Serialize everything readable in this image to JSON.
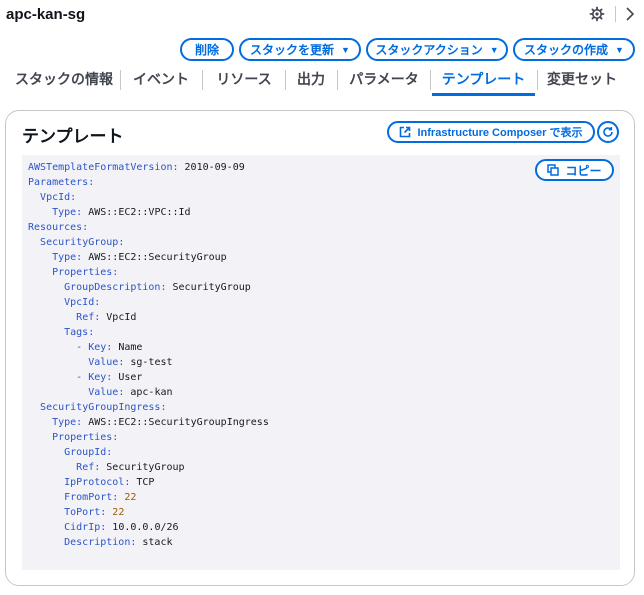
{
  "header": {
    "stack_name": "apc-kan-sg"
  },
  "actions": {
    "delete": "削除",
    "update": "スタックを更新",
    "stack_actions": "スタックアクション",
    "create": "スタックの作成"
  },
  "tabs": [
    {
      "label": "スタックの情報"
    },
    {
      "label": "イベント"
    },
    {
      "label": "リソース"
    },
    {
      "label": "出力"
    },
    {
      "label": "パラメータ"
    },
    {
      "label": "テンプレート"
    },
    {
      "label": "変更セット"
    }
  ],
  "panel": {
    "title": "テンプレート",
    "composer_label": "Infrastructure Composer で表示",
    "copy_label": "コピー"
  },
  "template_lines": [
    {
      "indent": "",
      "key": "AWSTemplateFormatVersion:",
      "value": " 2010-09-09",
      "vtype": "v"
    },
    {
      "indent": "",
      "key": "Parameters:",
      "value": "",
      "vtype": "v"
    },
    {
      "indent": "  ",
      "key": "VpcId:",
      "value": "",
      "vtype": "v"
    },
    {
      "indent": "    ",
      "key": "Type:",
      "value": " AWS::EC2::VPC::Id",
      "vtype": "v"
    },
    {
      "indent": "",
      "key": "Resources:",
      "value": "",
      "vtype": "v"
    },
    {
      "indent": "  ",
      "key": "SecurityGroup:",
      "value": "",
      "vtype": "v"
    },
    {
      "indent": "    ",
      "key": "Type:",
      "value": " AWS::EC2::SecurityGroup",
      "vtype": "v"
    },
    {
      "indent": "    ",
      "key": "Properties:",
      "value": "",
      "vtype": "v"
    },
    {
      "indent": "      ",
      "key": "GroupDescription:",
      "value": " SecurityGroup",
      "vtype": "v"
    },
    {
      "indent": "      ",
      "key": "VpcId:",
      "value": "",
      "vtype": "v"
    },
    {
      "indent": "        ",
      "key": "Ref:",
      "value": " VpcId",
      "vtype": "v"
    },
    {
      "indent": "      ",
      "key": "Tags:",
      "value": "",
      "vtype": "v"
    },
    {
      "indent": "        ",
      "key": "- Key:",
      "value": " Name",
      "vtype": "v"
    },
    {
      "indent": "          ",
      "key": "Value:",
      "value": " sg-test",
      "vtype": "v"
    },
    {
      "indent": "        ",
      "key": "- Key:",
      "value": " User",
      "vtype": "v"
    },
    {
      "indent": "          ",
      "key": "Value:",
      "value": " apc-kan",
      "vtype": "v"
    },
    {
      "indent": "  ",
      "key": "SecurityGroupIngress:",
      "value": "",
      "vtype": "v"
    },
    {
      "indent": "    ",
      "key": "Type:",
      "value": " AWS::EC2::SecurityGroupIngress",
      "vtype": "v"
    },
    {
      "indent": "    ",
      "key": "Properties:",
      "value": "",
      "vtype": "v"
    },
    {
      "indent": "      ",
      "key": "GroupId:",
      "value": "",
      "vtype": "v"
    },
    {
      "indent": "        ",
      "key": "Ref:",
      "value": " SecurityGroup",
      "vtype": "v"
    },
    {
      "indent": "      ",
      "key": "IpProtocol:",
      "value": " TCP",
      "vtype": "v"
    },
    {
      "indent": "      ",
      "key": "FromPort:",
      "value": " 22",
      "vtype": "n"
    },
    {
      "indent": "      ",
      "key": "ToPort:",
      "value": " 22",
      "vtype": "n"
    },
    {
      "indent": "      ",
      "key": "CidrIp:",
      "value": " 10.0.0.0/26",
      "vtype": "v"
    },
    {
      "indent": "      ",
      "key": "Description:",
      "value": " stack",
      "vtype": "v"
    }
  ],
  "colors": {
    "accent": "#006ce0",
    "yaml_key": "#2a54c8",
    "yaml_number": "#9a5b00"
  }
}
